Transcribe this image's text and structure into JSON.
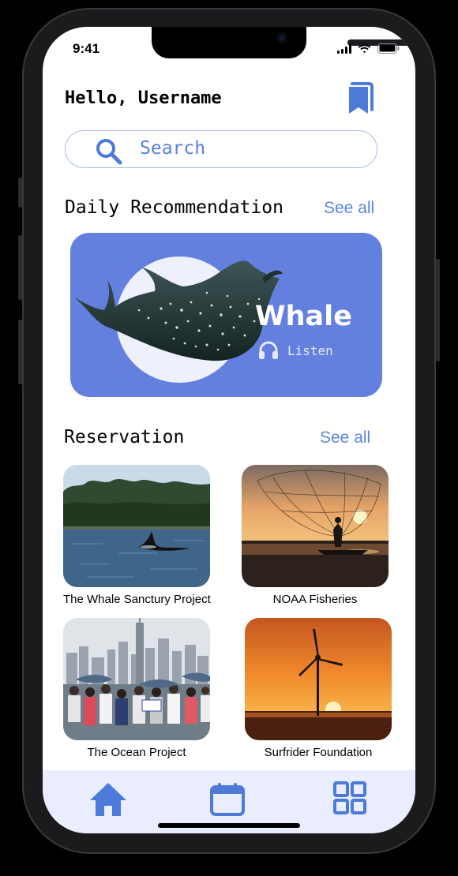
{
  "status_bar": {
    "time": "9:41"
  },
  "header": {
    "greeting": "Hello, Username"
  },
  "search": {
    "placeholder": "Search"
  },
  "daily": {
    "title": "Daily Recommendation",
    "see_all": "See all",
    "card": {
      "name": "Whale",
      "listen_label": "Listen"
    }
  },
  "reservation": {
    "title": "Reservation",
    "see_all": "See all",
    "items": [
      {
        "label": "The Whale Sanctury Project"
      },
      {
        "label": "NOAA Fisheries"
      },
      {
        "label": "The Ocean Project"
      },
      {
        "label": "Surfrider Foundation"
      }
    ]
  },
  "tabbar": {
    "tabs": [
      "home-icon",
      "calendar-icon",
      "grid-icon"
    ]
  },
  "colors": {
    "accent": "#6480DE",
    "link": "#5A86DF",
    "tabbar_bg": "#E9EDFD"
  }
}
